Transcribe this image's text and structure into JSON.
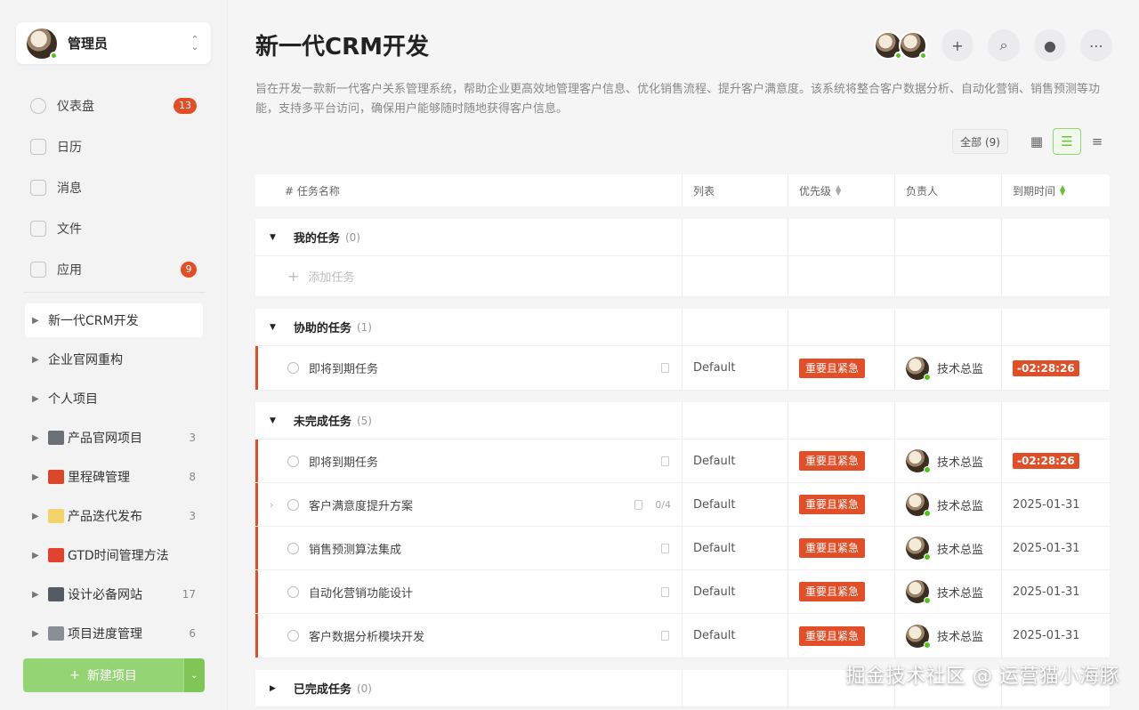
{
  "sidebar": {
    "user": {
      "name": "管理员"
    },
    "nav": [
      {
        "label": "仪表盘",
        "badge": "13"
      },
      {
        "label": "日历",
        "badge": ""
      },
      {
        "label": "消息",
        "badge": ""
      },
      {
        "label": "文件",
        "badge": ""
      },
      {
        "label": "应用",
        "badge": "9"
      }
    ],
    "projects": [
      {
        "label": "新一代CRM开发",
        "count": "",
        "emoji_color": ""
      },
      {
        "label": "企业官网重构",
        "count": "",
        "emoji_color": ""
      },
      {
        "label": "个人项目",
        "count": "",
        "emoji_color": ""
      },
      {
        "label": "产品官网项目",
        "count": "3",
        "emoji_color": "#6b6f76"
      },
      {
        "label": "里程碑管理",
        "count": "8",
        "emoji_color": "#d9472b"
      },
      {
        "label": "产品迭代发布",
        "count": "3",
        "emoji_color": "#f2d46b"
      },
      {
        "label": "GTD时间管理方法",
        "count": "",
        "emoji_color": "#e0442e"
      },
      {
        "label": "设计必备网站",
        "count": "17",
        "emoji_color": "#555b63"
      },
      {
        "label": "项目进度管理",
        "count": "6",
        "emoji_color": "#8a8f97"
      }
    ],
    "new_project_label": "新建项目"
  },
  "header": {
    "title": "新一代CRM开发",
    "description": "旨在开发一款新一代客户关系管理系统，帮助企业更高效地管理客户信息、优化销售流程、提升客户满意度。该系统将整合客户数据分析、自动化营销、销售预测等功能，支持多平台访问，确保用户能够随时随地获得客户信息。",
    "filter_label": "全部 (9)"
  },
  "table": {
    "columns": [
      "# 任务名称",
      "列表",
      "优先级",
      "负责人",
      "到期时间"
    ],
    "groups": [
      {
        "title": "我的任务",
        "count": "(0)",
        "collapsed": false,
        "add_label": "添加任务",
        "tasks": []
      },
      {
        "title": "协助的任务",
        "count": "(1)",
        "collapsed": false,
        "tasks": [
          {
            "name": "即将到期任务",
            "list": "Default",
            "priority": "重要且紧急",
            "assignee": "技术总监",
            "due": "-02:28:26",
            "overdue": true,
            "subtasks": "",
            "expandable": false
          }
        ]
      },
      {
        "title": "未完成任务",
        "count": "(5)",
        "collapsed": false,
        "tasks": [
          {
            "name": "即将到期任务",
            "list": "Default",
            "priority": "重要且紧急",
            "assignee": "技术总监",
            "due": "-02:28:26",
            "overdue": true,
            "subtasks": "",
            "expandable": false
          },
          {
            "name": "客户满意度提升方案",
            "list": "Default",
            "priority": "重要且紧急",
            "assignee": "技术总监",
            "due": "2025-01-31",
            "overdue": false,
            "subtasks": "0/4",
            "expandable": true
          },
          {
            "name": "销售预测算法集成",
            "list": "Default",
            "priority": "重要且紧急",
            "assignee": "技术总监",
            "due": "2025-01-31",
            "overdue": false,
            "subtasks": "",
            "expandable": false
          },
          {
            "name": "自动化营销功能设计",
            "list": "Default",
            "priority": "重要且紧急",
            "assignee": "技术总监",
            "due": "2025-01-31",
            "overdue": false,
            "subtasks": "",
            "expandable": false
          },
          {
            "name": "客户数据分析模块开发",
            "list": "Default",
            "priority": "重要且紧急",
            "assignee": "技术总监",
            "due": "2025-01-31",
            "overdue": false,
            "subtasks": "",
            "expandable": false
          }
        ]
      },
      {
        "title": "已完成任务",
        "count": "(0)",
        "collapsed": true,
        "tasks": []
      }
    ]
  },
  "watermark": "掘金技术社区 @ 运营猫小海豚",
  "colors": {
    "accent": "#e24e27",
    "brand_green": "#95d475"
  }
}
